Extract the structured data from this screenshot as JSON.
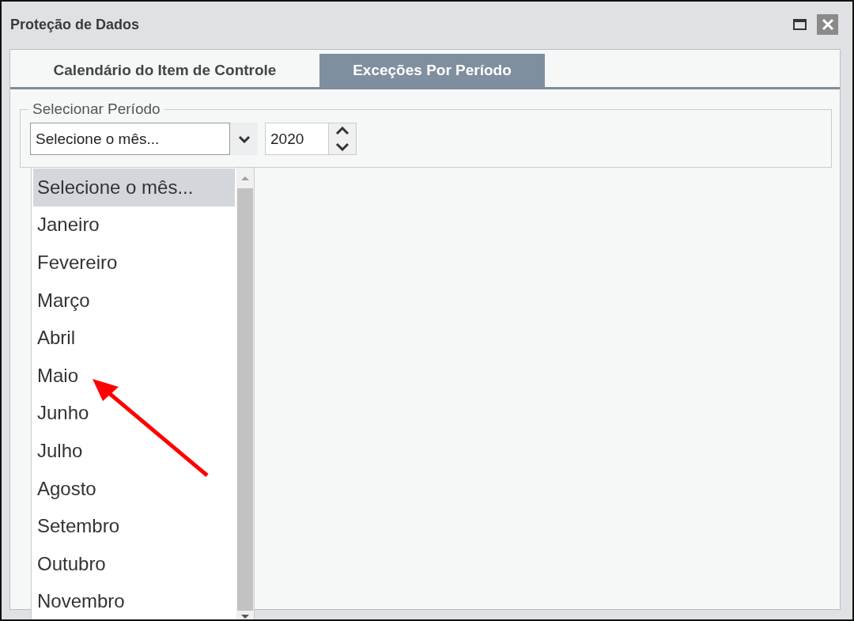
{
  "window": {
    "title": "Proteção de Dados"
  },
  "tabs": [
    {
      "label": "Calendário do Item de Controle",
      "selected": false
    },
    {
      "label": "Exceções Por Período",
      "selected": true
    }
  ],
  "period_group": {
    "legend": "Selecionar Período",
    "month_select": {
      "value": "Selecione o mês...",
      "expanded": true
    },
    "year_spinner": {
      "value": "2020"
    }
  },
  "month_options": [
    {
      "label": "Selecione o mês...",
      "selected": true
    },
    {
      "label": "Janeiro",
      "selected": false
    },
    {
      "label": "Fevereiro",
      "selected": false
    },
    {
      "label": "Março",
      "selected": false
    },
    {
      "label": "Abril",
      "selected": false
    },
    {
      "label": "Maio",
      "selected": false
    },
    {
      "label": "Junho",
      "selected": false
    },
    {
      "label": "Julho",
      "selected": false
    },
    {
      "label": "Agosto",
      "selected": false
    },
    {
      "label": "Setembro",
      "selected": false
    },
    {
      "label": "Outubro",
      "selected": false
    },
    {
      "label": "Novembro",
      "selected": false
    }
  ]
}
